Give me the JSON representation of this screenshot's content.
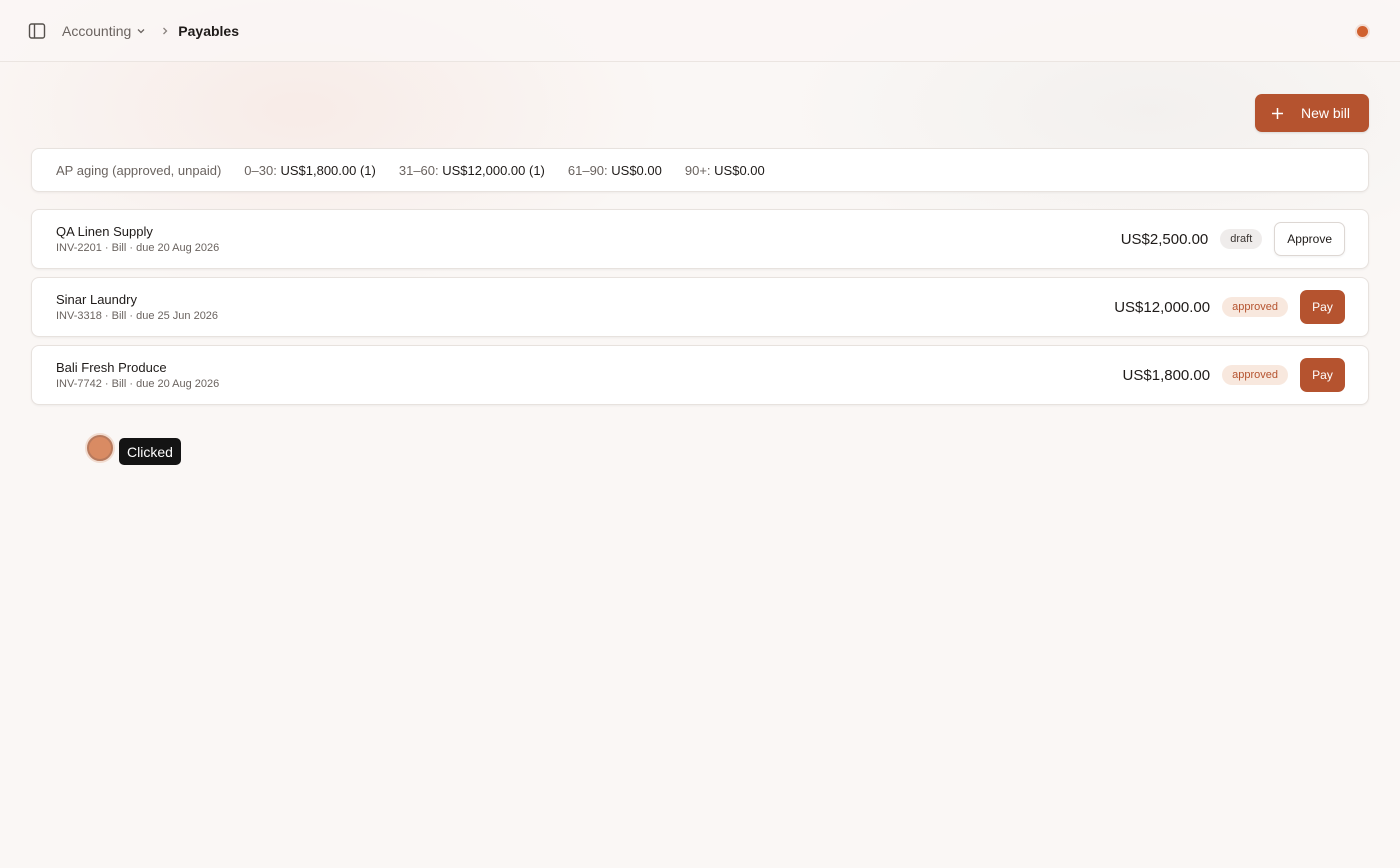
{
  "breadcrumb": {
    "parent": "Accounting",
    "current": "Payables"
  },
  "toolbar": {
    "new_bill_label": "New bill"
  },
  "aging": {
    "title": "AP aging (approved, unpaid)",
    "buckets": [
      {
        "label": "0–30:",
        "value": "US$1,800.00 (1)"
      },
      {
        "label": "31–60:",
        "value": "US$12,000.00 (1)"
      },
      {
        "label": "61–90:",
        "value": "US$0.00"
      },
      {
        "label": "90+:",
        "value": "US$0.00"
      }
    ]
  },
  "bills": [
    {
      "vendor": "QA Linen Supply",
      "meta": "INV-2201 · Bill · due 20 Aug 2026",
      "amount": "US$2,500.00",
      "status": "draft",
      "action": "Approve"
    },
    {
      "vendor": "Sinar Laundry",
      "meta": "INV-3318 · Bill · due 25 Jun 2026",
      "amount": "US$12,000.00",
      "status": "approved",
      "action": "Pay"
    },
    {
      "vendor": "Bali Fresh Produce",
      "meta": "INV-7742 · Bill · due 20 Aug 2026",
      "amount": "US$1,800.00",
      "status": "approved",
      "action": "Pay"
    }
  ],
  "click_indicator": {
    "label": "Clicked"
  },
  "colors": {
    "accent": "#b5532f",
    "status_dot": "#d0612f",
    "draft_badge_bg": "#efeceb",
    "approved_badge_bg": "#f8e8de"
  },
  "icons": {
    "sidebar_toggle": "sidebar-panel-icon",
    "breadcrumb_dropdown": "chevron-down-icon",
    "breadcrumb_separator": "chevron-right-icon",
    "new_bill": "plus-icon"
  }
}
